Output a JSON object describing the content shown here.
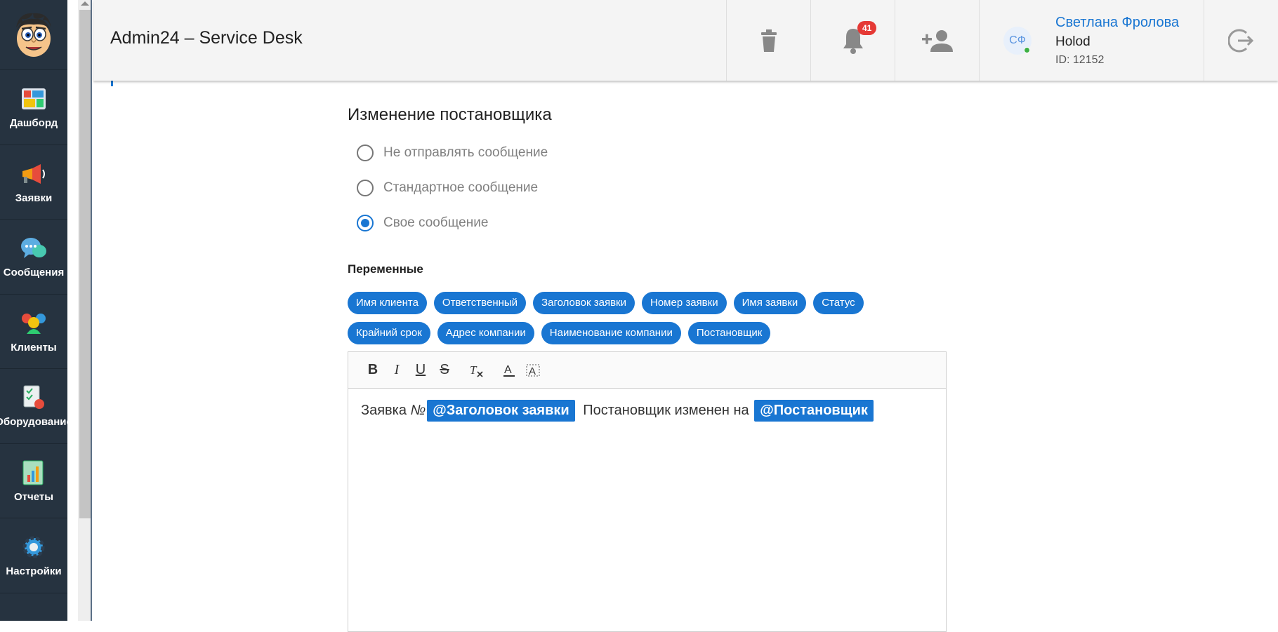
{
  "app": {
    "title": "Admin24 – Service Desk"
  },
  "sidebar": {
    "items": [
      {
        "label": "Дашборд",
        "icon": "dashboard-icon"
      },
      {
        "label": "Заявки",
        "icon": "megaphone-icon"
      },
      {
        "label": "Сообщения",
        "icon": "chat-icon"
      },
      {
        "label": "Клиенты",
        "icon": "clients-icon"
      },
      {
        "label": "Оборудование",
        "icon": "equipment-icon"
      },
      {
        "label": "Отчеты",
        "icon": "reports-icon"
      },
      {
        "label": "Настройки",
        "icon": "settings-icon"
      }
    ]
  },
  "header": {
    "notifications_count": "41",
    "user": {
      "initials": "СФ",
      "name": "Светлана Фролова",
      "company": "Holod",
      "id": "ID: 12152"
    }
  },
  "form": {
    "title": "Изменение постановщика",
    "radios": [
      {
        "label": "Не отправлять сообщение",
        "checked": false
      },
      {
        "label": "Стандартное сообщение",
        "checked": false
      },
      {
        "label": "Свое сообщение",
        "checked": true
      }
    ],
    "variables_heading": "Переменные",
    "variables_row1": [
      "Имя клиента",
      "Ответственный",
      "Заголовок заявки",
      "Номер заявки",
      "Имя заявки",
      "Статус"
    ],
    "variables_row2": [
      "Крайний срок",
      "Адрес компании",
      "Наименование компании",
      "Постановщик"
    ]
  },
  "editor": {
    "text_part1": "Заявка ",
    "text_part2": "№",
    "mention1": "@Заголовок заявки",
    "text_part3": " Постановщик изменен на ",
    "mention2": "@Постановщик"
  },
  "colors": {
    "accent": "#1976d2",
    "sidebar": "#263340",
    "badge": "#e53935"
  }
}
